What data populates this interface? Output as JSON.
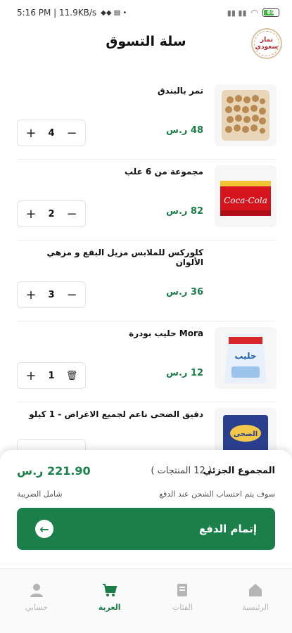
{
  "status": {
    "time": "5:16 PM | 11.9KB/s",
    "battery": "69"
  },
  "header": {
    "title": "سلة التسوق",
    "logo_text_top": "تمار",
    "logo_text_bottom": "سعودي"
  },
  "items": [
    {
      "name": "تمر بالبندق",
      "price": "48 ر.س",
      "qty": "4",
      "left_action": "−"
    },
    {
      "name": "مجموعة من 6 علب",
      "price": "82 ر.س",
      "qty": "2",
      "left_action": "−"
    },
    {
      "name": "كلوركس للملابس مزيل البقع و مزهي الألوان",
      "price": "36 ر.س",
      "qty": "3",
      "left_action": "−"
    },
    {
      "name": "Mora حليب بودرة",
      "price": "12 ر.س",
      "qty": "1",
      "left_action": "🗑"
    },
    {
      "name": "دقيق الضحى ناعم لجميع الاغراض - 1 كيلو",
      "price": "",
      "qty": "",
      "left_action": ""
    }
  ],
  "checkout": {
    "subtotal_label": "المجموع الجزئي",
    "items_count": "( 12 المنتجات )",
    "subtotal_value": "221.90 ر.س",
    "shipping_note": "سوف يتم احتساب الشحن عند الدفع",
    "tax_note": "شامل الضريبة",
    "button_label": "إتمام الدفع"
  },
  "nav": [
    {
      "label": "الرئيسية",
      "icon": "home-icon"
    },
    {
      "label": "الفئات",
      "icon": "categories-icon"
    },
    {
      "label": "العربة",
      "icon": "cart-icon",
      "active": true
    },
    {
      "label": "حسابي",
      "icon": "account-icon"
    }
  ],
  "colors": {
    "accent": "#1b7f4a"
  }
}
